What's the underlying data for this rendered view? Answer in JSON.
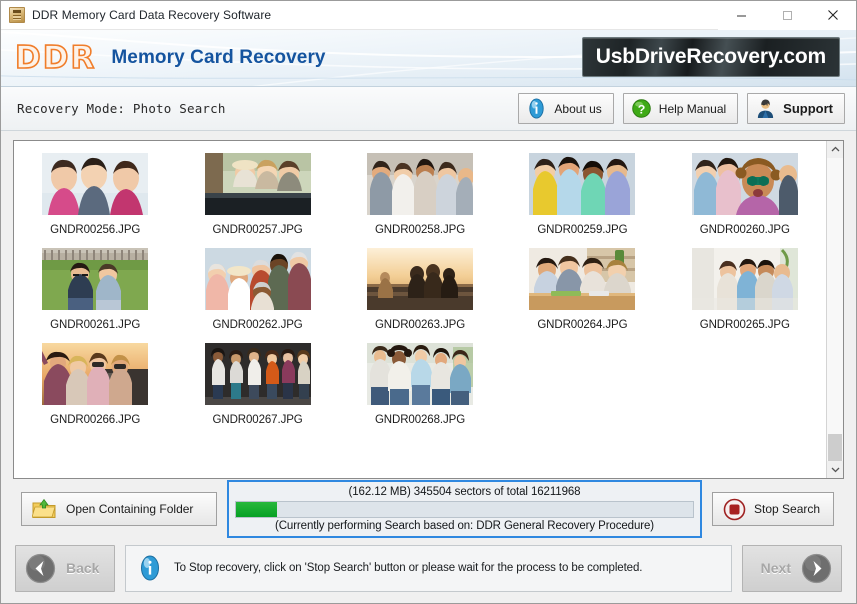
{
  "window": {
    "title": "DDR Memory Card Data Recovery Software",
    "app_icon": "memory-card-icon",
    "controls": {
      "minimize": "minimize-icon",
      "maximize": "maximize-icon",
      "close": "close-icon"
    }
  },
  "banner": {
    "logo_text": "DDR",
    "title": "Memory Card Recovery",
    "brand_badge": "UsbDriveRecovery.com",
    "brand_color": "#15549f",
    "logo_color": "#f07d2a"
  },
  "toolbar": {
    "mode_label": "Recovery Mode:  Photo Search",
    "buttons": [
      {
        "label": "About us",
        "icon": "info-icon"
      },
      {
        "label": "Help Manual",
        "icon": "question-icon"
      },
      {
        "label": "Support",
        "icon": "support-person-icon"
      }
    ]
  },
  "file_grid": {
    "files": [
      {
        "name": "GNDR00256.JPG"
      },
      {
        "name": "GNDR00257.JPG"
      },
      {
        "name": "GNDR00258.JPG"
      },
      {
        "name": "GNDR00259.JPG"
      },
      {
        "name": "GNDR00260.JPG"
      },
      {
        "name": "GNDR00261.JPG"
      },
      {
        "name": "GNDR00262.JPG"
      },
      {
        "name": "GNDR00263.JPG"
      },
      {
        "name": "GNDR00264.JPG"
      },
      {
        "name": "GNDR00265.JPG"
      },
      {
        "name": "GNDR00266.JPG"
      },
      {
        "name": "GNDR00267.JPG"
      },
      {
        "name": "GNDR00268.JPG"
      }
    ],
    "scrollbar": {
      "up_arrow": "chevron-up-icon",
      "down_arrow": "chevron-down-icon",
      "thumb_position": "bottom"
    }
  },
  "actions": {
    "open_folder": {
      "label": "Open Containing Folder",
      "icon": "open-folder-icon"
    },
    "stop_search": {
      "label": "Stop Search",
      "icon": "stop-square-icon"
    }
  },
  "progress": {
    "status_text": "(162.12 MB) 345504  sectors  of  total 16211968",
    "procedure_text": "(Currently performing Search based on:  DDR General Recovery Procedure)",
    "percent": 9,
    "fill_color": "#12a82b",
    "border_color": "#2f88e0"
  },
  "footer": {
    "back_label": "Back",
    "next_label": "Next",
    "back_icon": "chevron-left-circle-icon",
    "next_icon": "chevron-right-circle-icon",
    "status_icon": "info-icon",
    "status_message": "To Stop recovery, click on 'Stop Search' button or please wait for the process to be completed."
  }
}
